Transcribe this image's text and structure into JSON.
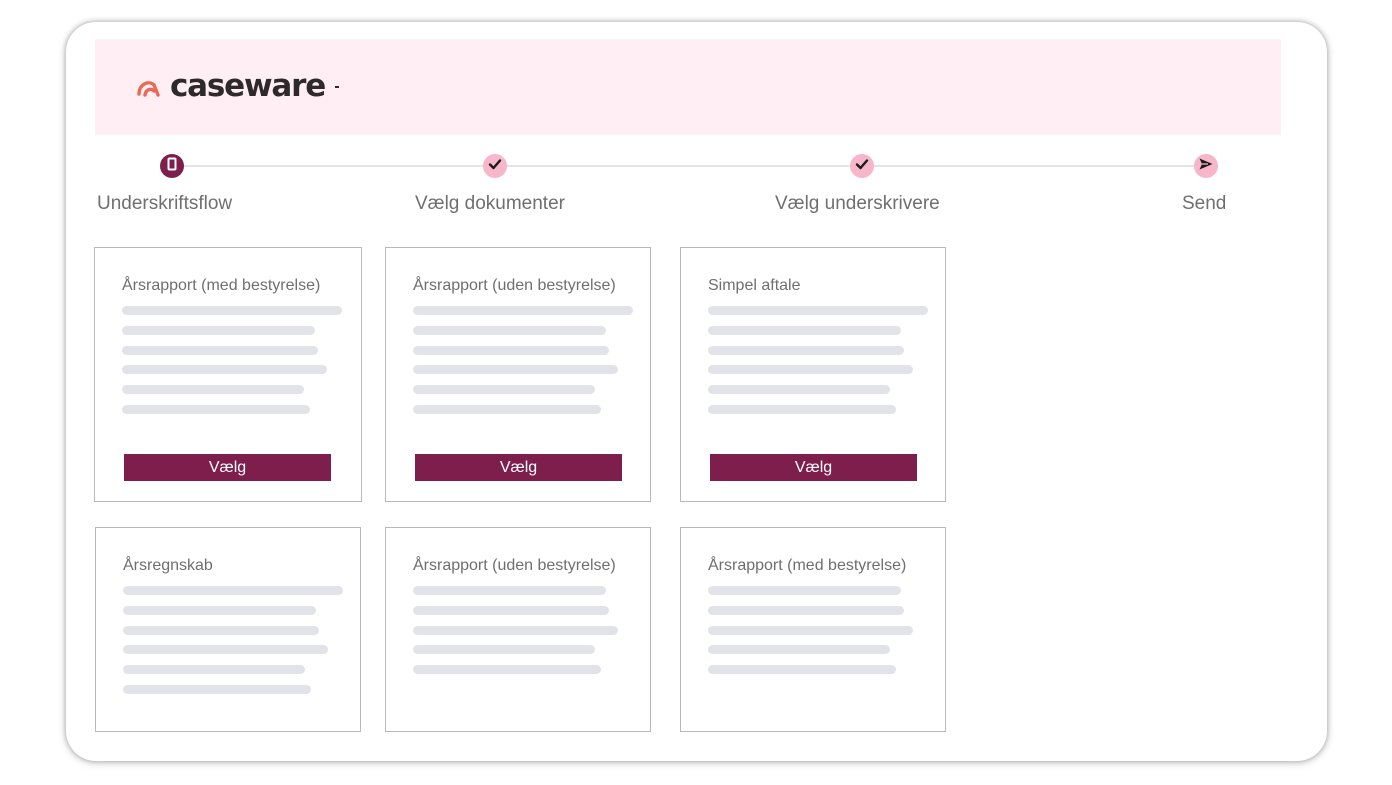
{
  "brand": {
    "name": "caseware",
    "accent_color": "#7d1e4c",
    "logo_icon": "caseware-mark-icon",
    "logo_icon_color": "#e86a56",
    "header_bg": "#ffeff4"
  },
  "steps": [
    {
      "label": "Underskriftsflow",
      "state": "active",
      "icon": "document-icon"
    },
    {
      "label": "Vælg dokumenter",
      "state": "done",
      "icon": "checkmark-icon"
    },
    {
      "label": "Vælg underskrivere",
      "state": "done",
      "icon": "checkmark-icon"
    },
    {
      "label": "Send",
      "state": "done",
      "icon": "send-icon"
    }
  ],
  "cards": [
    {
      "title": "Årsrapport (med bestyrelse)",
      "button_label": "Vælg"
    },
    {
      "title": "Årsrapport (uden bestyrelse)",
      "button_label": "Vælg"
    },
    {
      "title": "Simpel aftale",
      "button_label": "Vælg"
    },
    {
      "title": "Årsregnskab"
    },
    {
      "title": "Årsrapport (uden bestyrelse)"
    },
    {
      "title": "Årsrapport (med bestyrelse)"
    }
  ]
}
